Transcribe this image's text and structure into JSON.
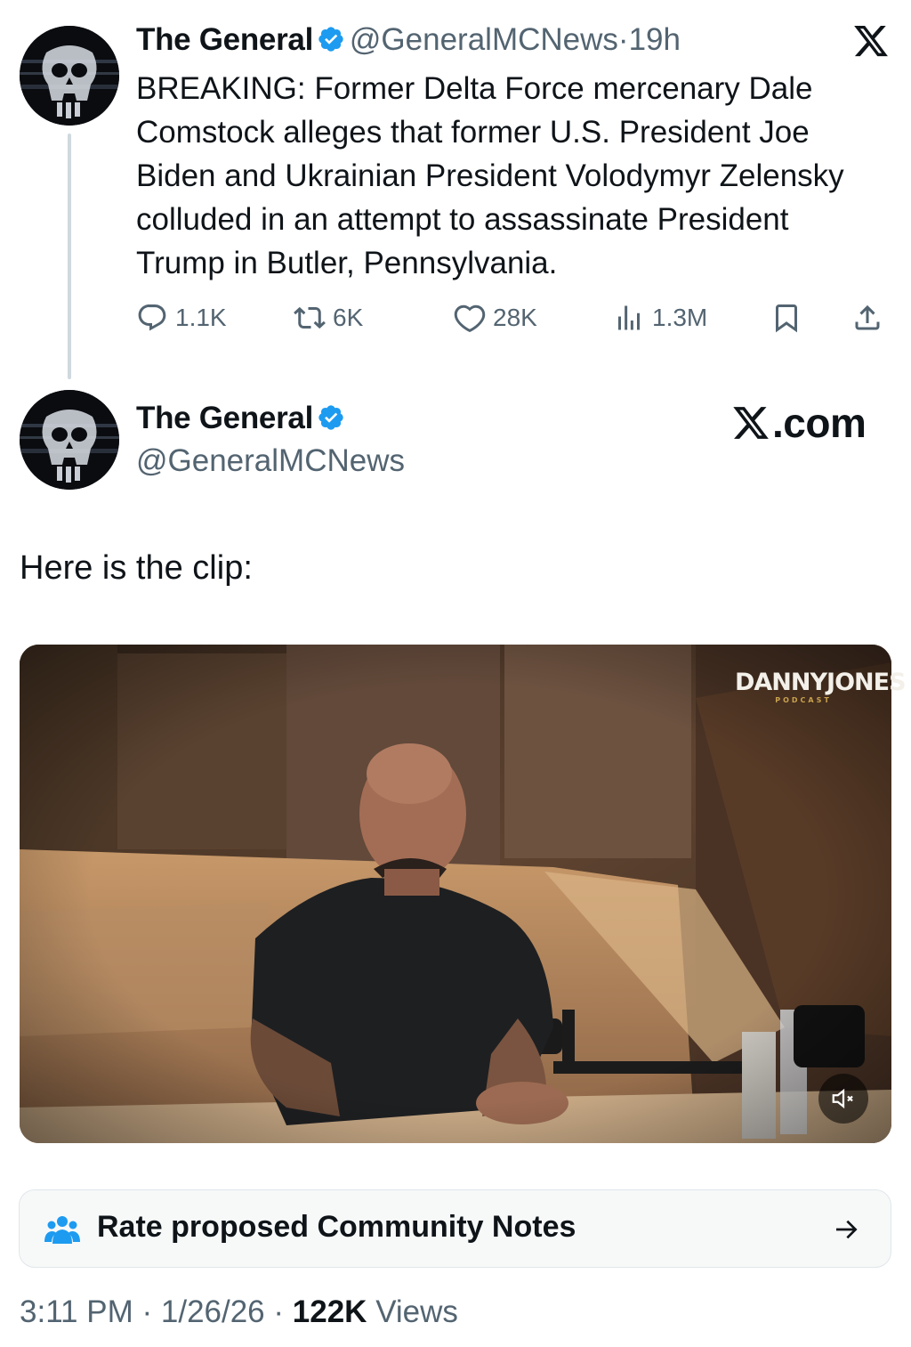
{
  "quoted_tweet": {
    "author_name": "The General",
    "handle": "@GeneralMCNews",
    "separator": "·",
    "time": "19h",
    "text": "BREAKING: Former Delta Force mercenary Dale Comstock alleges that former U.S. President Joe Biden and Ukrainian President Volodymyr Zelensky colluded in an attempt to assassinate President Trump in Butler, Pennsylvania.",
    "actions": {
      "replies": "1.1K",
      "reposts": "6K",
      "likes": "28K",
      "views": "1.3M"
    }
  },
  "main_tweet": {
    "author_name": "The General",
    "handle": "@GeneralMCNews",
    "text": "Here is the clip:",
    "media": {
      "brand_title": "DANNYJONES",
      "brand_subtitle": "PODCAST"
    }
  },
  "watermark": {
    "site": ".com",
    "logo_icon": "x-logo-icon"
  },
  "community_notes": {
    "label": "Rate proposed Community Notes",
    "icon": "people-icon"
  },
  "footer": {
    "time": "3:11 PM",
    "sep1": "·",
    "date": "1/26/26",
    "sep2": "·",
    "views_count": "122K",
    "views_label": "Views"
  },
  "colors": {
    "text_primary": "#0f1419",
    "text_secondary": "#536471",
    "verified_blue": "#1d9bf0",
    "notes_blue": "#1d9bf0"
  }
}
